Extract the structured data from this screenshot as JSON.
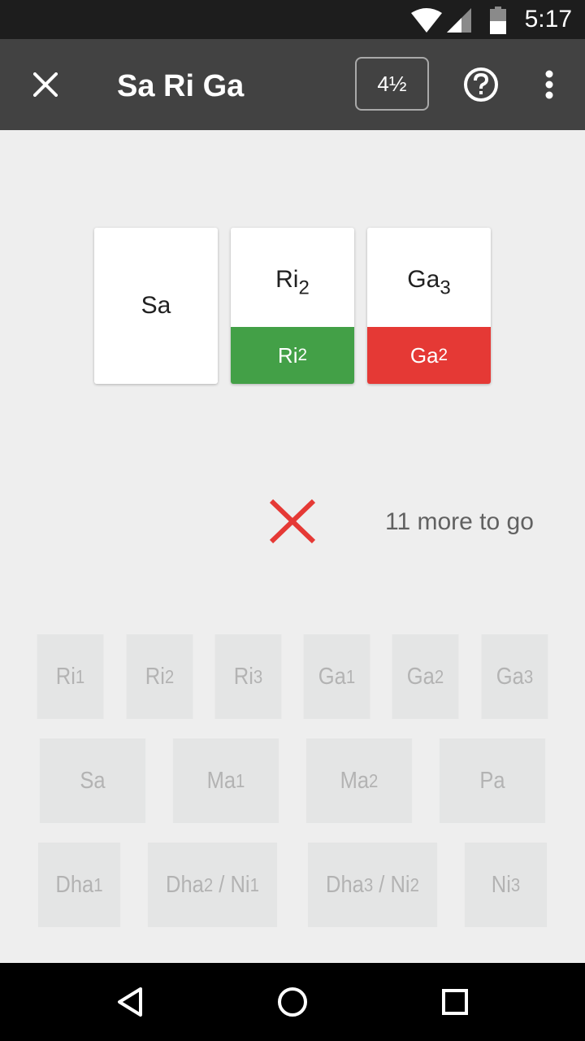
{
  "status_bar": {
    "time": "5:17"
  },
  "app_bar": {
    "title": "Sa Ri Ga",
    "level_label": "4½",
    "icons": [
      "close-icon",
      "help-icon",
      "more-vert-icon"
    ]
  },
  "cards": [
    {
      "note": "Sa",
      "note_sub": "",
      "answer": "",
      "answer_sub": "",
      "result": "none"
    },
    {
      "note": "Ri",
      "note_sub": "2",
      "answer": "Ri",
      "answer_sub": "2",
      "result": "correct"
    },
    {
      "note": "Ga",
      "note_sub": "3",
      "answer": "Ga",
      "answer_sub": "2",
      "result": "wrong"
    }
  ],
  "feedback": {
    "icon": "wrong-x-icon",
    "remaining_text": "11 more to go"
  },
  "keypad": {
    "row1": [
      {
        "label": "Ri",
        "sub": "1"
      },
      {
        "label": "Ri",
        "sub": "2"
      },
      {
        "label": "Ri",
        "sub": "3"
      },
      {
        "label": "Ga",
        "sub": "1"
      },
      {
        "label": "Ga",
        "sub": "2"
      },
      {
        "label": "Ga",
        "sub": "3"
      }
    ],
    "row2": [
      {
        "label": "Sa",
        "sub": ""
      },
      {
        "label": "Ma",
        "sub": "1"
      },
      {
        "label": "Ma",
        "sub": "2"
      },
      {
        "label": "Pa",
        "sub": ""
      }
    ],
    "row3": [
      {
        "label": "Dha",
        "sub": "1"
      },
      {
        "label": "Dha",
        "sub": "2",
        "label2": " / Ni",
        "sub2": "1"
      },
      {
        "label": "Dha",
        "sub": "3",
        "label2": " / Ni",
        "sub2": "2"
      },
      {
        "label": "Ni",
        "sub": "3"
      }
    ]
  },
  "colors": {
    "app_bar": "#424242",
    "correct": "#43a047",
    "wrong": "#e53935",
    "key_bg": "#e4e5e5",
    "key_text": "#b3b3b3"
  },
  "nav_bar": {
    "icons": [
      "back-icon",
      "home-icon",
      "recents-icon"
    ]
  }
}
